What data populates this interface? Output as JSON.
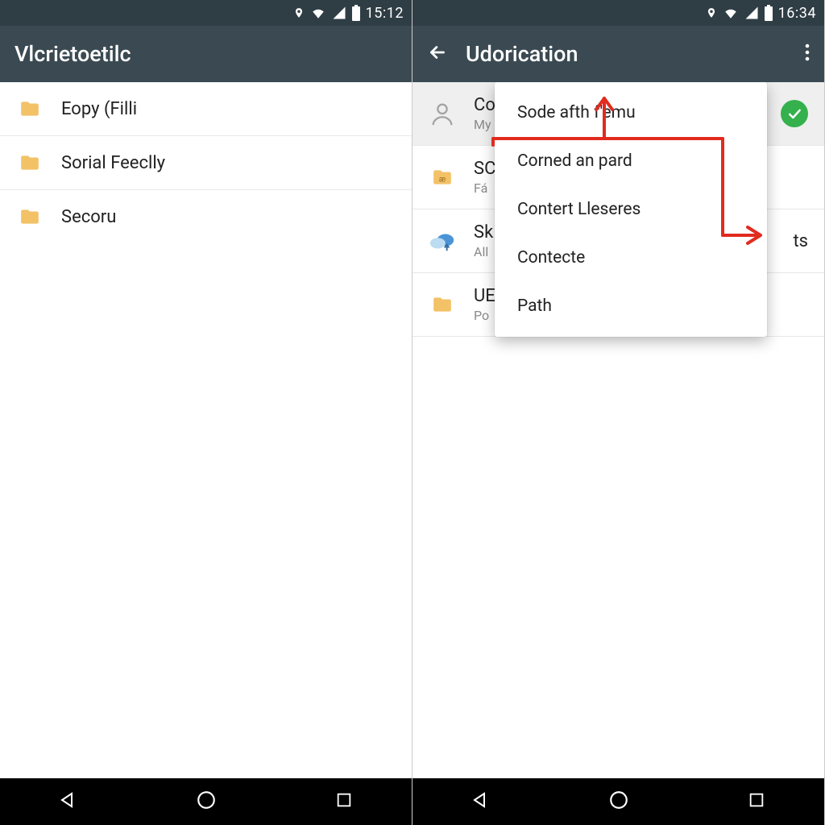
{
  "left": {
    "status": {
      "time": "15:12"
    },
    "app": {
      "title": "Vlcrietoetilc"
    },
    "rows": [
      {
        "label": "Eopy (Filli"
      },
      {
        "label": "Sorial Feeclly"
      },
      {
        "label": "Secoru"
      }
    ]
  },
  "right": {
    "status": {
      "time": "16:34"
    },
    "app": {
      "title": "Udorication"
    },
    "rows": [
      {
        "label": "Co",
        "sub": "My",
        "icon": "person",
        "checked": true
      },
      {
        "label": "SC",
        "sub": "Fá",
        "icon": "folder-a"
      },
      {
        "label": "Sk",
        "sub": "All",
        "icon": "cloud",
        "trail": "ts"
      },
      {
        "label": "UE",
        "sub": "Po",
        "icon": "folder"
      }
    ],
    "popup": [
      "Sode afth f'emu",
      "Corned an pard",
      "Contert Lleseres",
      "Contecte",
      "Path"
    ]
  },
  "colors": {
    "statusbar": "#2f3d44",
    "appbar": "#3b4a52",
    "folder": "#f3c267",
    "annotation": "#e12b1f",
    "check": "#34b14c"
  }
}
